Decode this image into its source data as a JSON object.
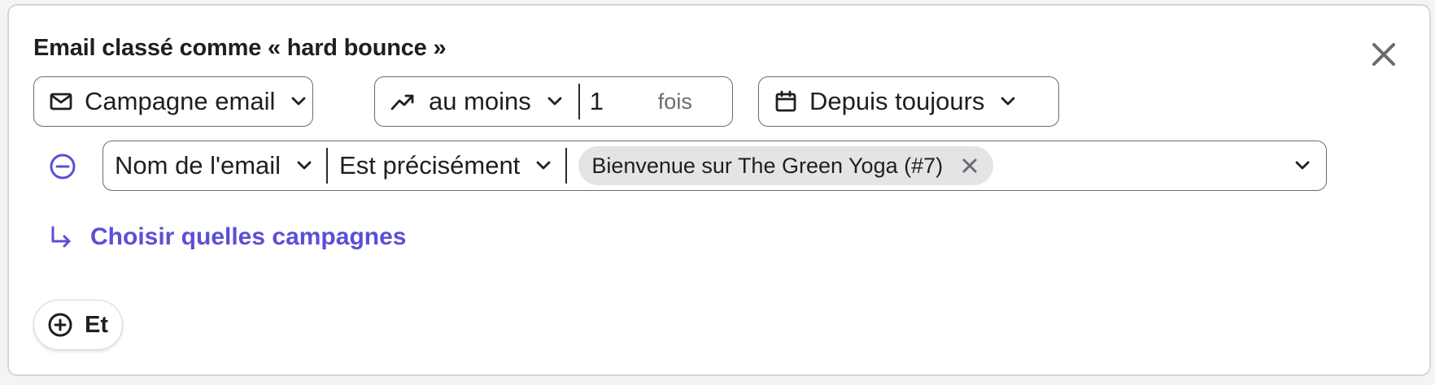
{
  "condition": {
    "title": "Email classé comme « hard bounce »"
  },
  "filters": {
    "source": {
      "label": "Campagne email",
      "icon": "envelope-icon"
    },
    "frequency": {
      "operator": "au moins",
      "count": "1",
      "unit": "fois",
      "icon": "trend-up-icon"
    },
    "period": {
      "label": "Depuis toujours",
      "icon": "calendar-icon"
    }
  },
  "email_filter": {
    "field": "Nom de l'email",
    "operator": "Est précisément",
    "values": [
      "Bienvenue sur The Green Yoga (#7)"
    ]
  },
  "choose_link": {
    "label": "Choisir quelles campagnes",
    "icon": "arrow-turn-down-right-icon"
  },
  "and_button": {
    "label": "Et",
    "icon": "plus-circle-icon"
  },
  "colors": {
    "accent": "#5b4fd6",
    "border": "#6b6b70",
    "tag_bg": "#e4e4e6"
  }
}
